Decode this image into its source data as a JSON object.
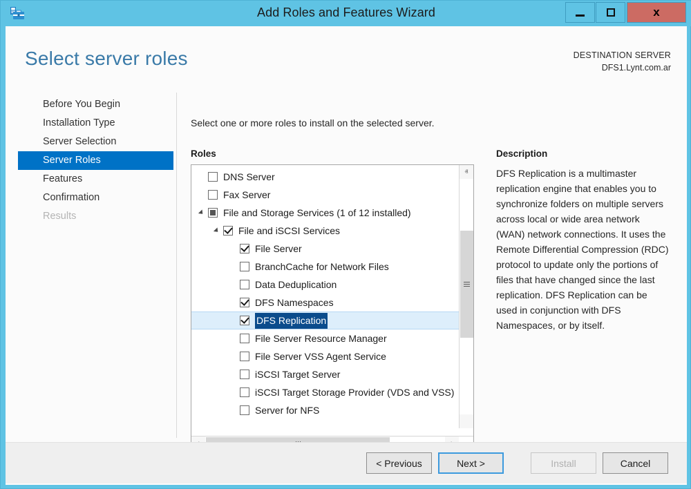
{
  "window": {
    "title": "Add Roles and Features Wizard",
    "icon": "server-manager-icon",
    "minimize_label": "–",
    "maximize_label": "□",
    "close_label": "x"
  },
  "header": {
    "page_title": "Select server roles",
    "destination_label": "DESTINATION SERVER",
    "destination_server": "DFS1.Lynt.com.ar"
  },
  "nav": {
    "items": [
      {
        "label": "Before You Begin",
        "state": "normal"
      },
      {
        "label": "Installation Type",
        "state": "normal"
      },
      {
        "label": "Server Selection",
        "state": "normal"
      },
      {
        "label": "Server Roles",
        "state": "selected"
      },
      {
        "label": "Features",
        "state": "normal"
      },
      {
        "label": "Confirmation",
        "state": "normal"
      },
      {
        "label": "Results",
        "state": "disabled"
      }
    ]
  },
  "main": {
    "instruction": "Select one or more roles to install on the selected server.",
    "roles_label": "Roles",
    "roles": [
      {
        "label": "DNS Server",
        "indent": 0,
        "checkbox": "unchecked",
        "expander": "none",
        "selected": false
      },
      {
        "label": "Fax Server",
        "indent": 0,
        "checkbox": "unchecked",
        "expander": "none",
        "selected": false
      },
      {
        "label": "File and Storage Services (1 of 12 installed)",
        "indent": 0,
        "checkbox": "partial",
        "expander": "expanded",
        "selected": false
      },
      {
        "label": "File and iSCSI Services",
        "indent": 1,
        "checkbox": "checked",
        "expander": "expanded",
        "selected": false
      },
      {
        "label": "File Server",
        "indent": 2,
        "checkbox": "checked",
        "expander": "none",
        "selected": false
      },
      {
        "label": "BranchCache for Network Files",
        "indent": 2,
        "checkbox": "unchecked",
        "expander": "none",
        "selected": false
      },
      {
        "label": "Data Deduplication",
        "indent": 2,
        "checkbox": "unchecked",
        "expander": "none",
        "selected": false
      },
      {
        "label": "DFS Namespaces",
        "indent": 2,
        "checkbox": "checked",
        "expander": "none",
        "selected": false
      },
      {
        "label": "DFS Replication",
        "indent": 2,
        "checkbox": "checked",
        "expander": "none",
        "selected": true
      },
      {
        "label": "File Server Resource Manager",
        "indent": 2,
        "checkbox": "unchecked",
        "expander": "none",
        "selected": false
      },
      {
        "label": "File Server VSS Agent Service",
        "indent": 2,
        "checkbox": "unchecked",
        "expander": "none",
        "selected": false
      },
      {
        "label": "iSCSI Target Server",
        "indent": 2,
        "checkbox": "unchecked",
        "expander": "none",
        "selected": false
      },
      {
        "label": "iSCSI Target Storage Provider (VDS and VSS)",
        "indent": 2,
        "checkbox": "unchecked",
        "expander": "none",
        "selected": false
      },
      {
        "label": "Server for NFS",
        "indent": 2,
        "checkbox": "unchecked",
        "expander": "none",
        "selected": false
      }
    ],
    "scroll": {
      "up_arrow": "ⱏ",
      "down_arrow": "ⱟ",
      "left_arrow": "‹",
      "right_arrow": "›"
    }
  },
  "description": {
    "title": "Description",
    "body": "DFS Replication is a multimaster replication engine that enables you to synchronize folders on multiple servers across local or wide area network (WAN) network connections. It uses the Remote Differential Compression (RDC) protocol to update only the portions of files that have changed since the last replication. DFS Replication can be used in conjunction with DFS Namespaces, or by itself."
  },
  "footer": {
    "previous_label": "< Previous",
    "next_label": "Next >",
    "install_label": "Install",
    "cancel_label": "Cancel"
  },
  "colors": {
    "titlebar": "#5FC3E4",
    "accent_selected_nav": "#0072C6",
    "page_title": "#3a7aa8",
    "selected_row_band": "#DDEEFB",
    "selected_text_highlight": "#0B4C8C",
    "close_button": "#CC6B63"
  }
}
